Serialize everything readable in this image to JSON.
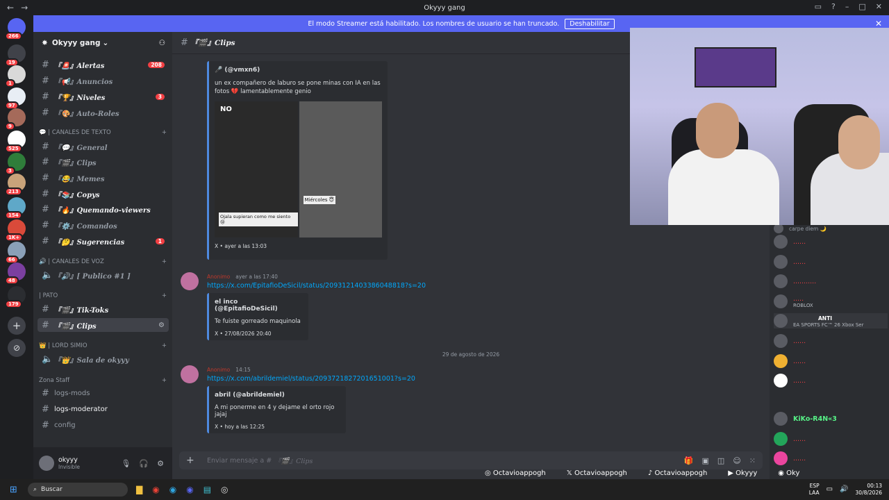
{
  "window": {
    "title": "Okyyy gang"
  },
  "banner": {
    "text": "El modo Streamer está habilitado. Los nombres de usuario se han truncado.",
    "button": "Deshabilitar"
  },
  "servers": [
    {
      "badge": "266"
    },
    {
      "badge": "19"
    },
    {
      "badge": "1"
    },
    {
      "badge": "97"
    },
    {
      "badge": "9"
    },
    {
      "badge": "525"
    },
    {
      "badge": "3"
    },
    {
      "badge": "213"
    },
    {
      "badge": "154"
    },
    {
      "badge": "1K+"
    },
    {
      "badge": "66"
    },
    {
      "badge": "48"
    },
    {
      "badge": "179"
    }
  ],
  "guild": {
    "name": "Okyyy gang"
  },
  "channels": [
    {
      "name": "『🚨』Alertas",
      "count": "208"
    },
    {
      "name": "『📢』Anuncios"
    },
    {
      "name": "『🏆』Niveles",
      "count": "3"
    },
    {
      "name": "『🎨』Auto-Roles"
    },
    {
      "category": "💬 | CANALES DE TEXTO"
    },
    {
      "name": "『💬』General"
    },
    {
      "name": "『🎬』Clips"
    },
    {
      "name": "『😂』Memes"
    },
    {
      "name": "『📚』Copys"
    },
    {
      "name": "『🔥』Quemando-viewers"
    },
    {
      "name": "『⚙️』Comandos"
    },
    {
      "name": "『🤔』Sugerencias",
      "count": "1"
    },
    {
      "category": "🔊 | CANALES DE VOZ"
    },
    {
      "name": "『🔊』[ Publico #1 ]"
    },
    {
      "category": "| PATO"
    },
    {
      "name": "『🎬』Tik-Toks"
    },
    {
      "name": "『🎬』Clips"
    },
    {
      "category": "👑 | LORD SIMIO"
    },
    {
      "name": "『👑』Sala de okyyy"
    },
    {
      "category": "Zona Staff"
    },
    {
      "name": "logs-mods"
    },
    {
      "name": "logs-moderator"
    },
    {
      "name": "config"
    }
  ],
  "user": {
    "name": "okyyy",
    "status": "Invisible"
  },
  "header": {
    "channel": "『🎬』Clips"
  },
  "messages": {
    "embed1": {
      "author": "🎤 (@vmxn6)",
      "text": "un ex compañero de laburo se pone minas con IA en las fotos 💔 lamentablemente genio",
      "image_label_no": "NO",
      "image_caption1": "Ojala supieran como me siento 😢",
      "image_caption2": "Miércoles 😇",
      "footer": "X • ayer a las 13:03"
    },
    "msg2": {
      "author": "Anonimo",
      "time": "ayer a las 17:40",
      "link": "https://x.com/EpitafioDeSicil/status/2093121403386048818?s=20",
      "embed": {
        "author": "el inco (@EpitafioDeSicil)",
        "text": "Te fuiste gorreado maquinola",
        "footer": "X • 27/08/2026 20:40"
      }
    },
    "date_sep": "29 de agosto de 2026",
    "msg3": {
      "author": "Anonimo",
      "time": "14:15",
      "link": "https://x.com/abrildemiel/status/2093721827201651001?s=20",
      "embed": {
        "author": "abril (@abrildemiel)",
        "text": "A mi ponerme en 4 y dejame el orto rojo jajaj",
        "footer": "X • hoy a las 12:25"
      }
    }
  },
  "composer": {
    "placeholder": "Enviar mensaje a #",
    "channel": "『🎬』Clips"
  },
  "members": [
    {
      "name": "carpe diem 🌙"
    },
    {
      "name": "......"
    },
    {
      "name": "......"
    },
    {
      "name": "..........."
    },
    {
      "name": "ROBLOX"
    },
    {
      "name": "ANTI"
    },
    {
      "name": "EA SPORTS FC™ 26 Xbox Ser"
    },
    {
      "name": "......"
    },
    {
      "name": "......"
    },
    {
      "name": "......"
    },
    {
      "name": "KiKo-R4N«3"
    },
    {
      "name": "......"
    },
    {
      "name": "......"
    }
  ],
  "socials": [
    "Octavioappogh",
    "Octavioappogh",
    "Octavioappogh",
    "Okyyy",
    "Oky"
  ],
  "taskbar": {
    "search": "Buscar",
    "lang": "ESP",
    "layout": "LAA",
    "time": "00:13",
    "date": "30/8/2026"
  }
}
